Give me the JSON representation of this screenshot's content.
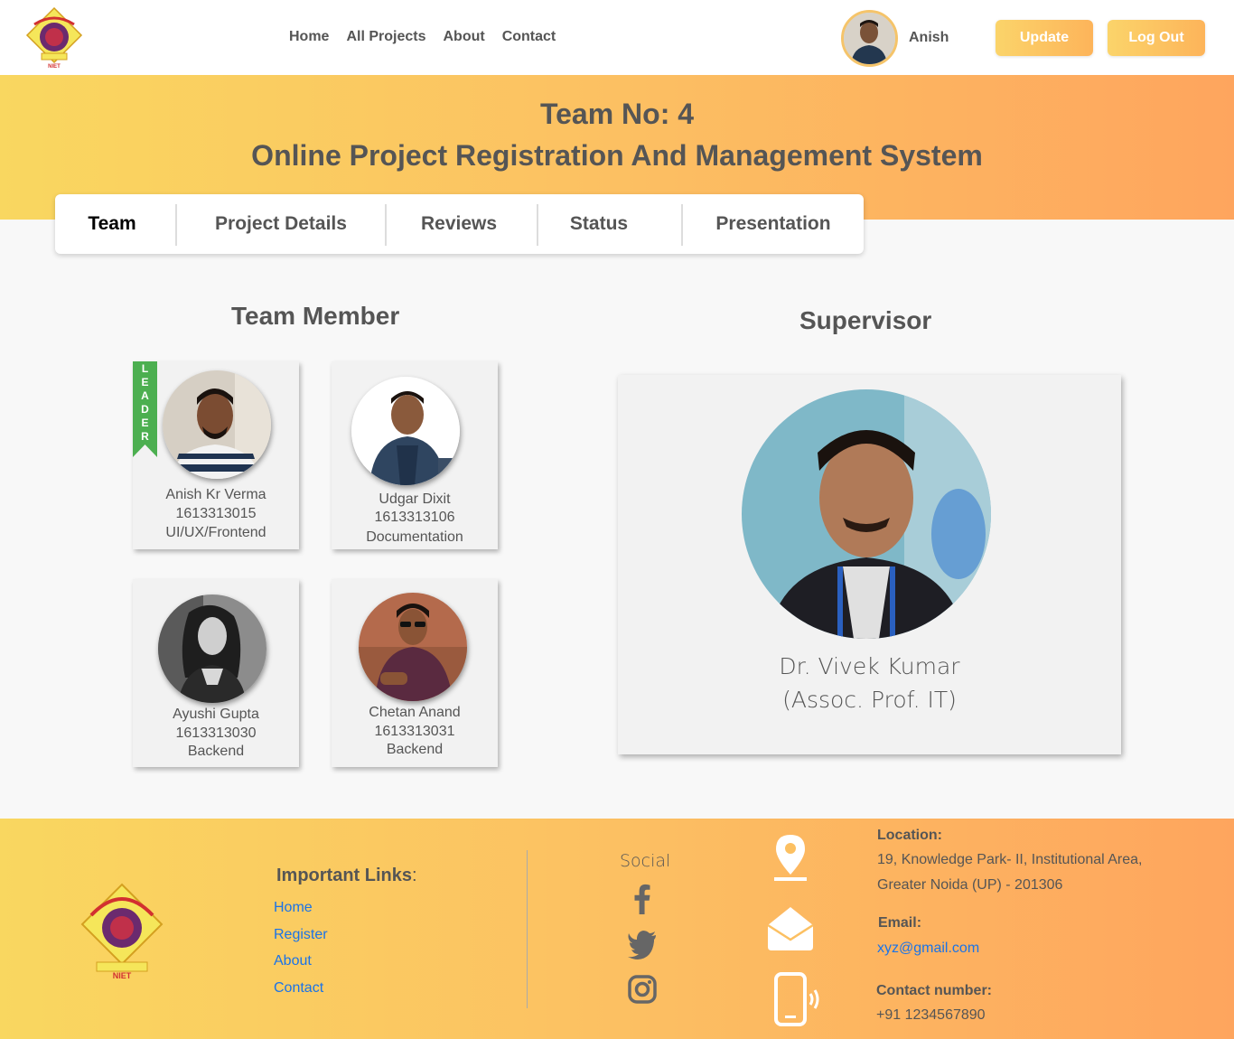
{
  "navbar": {
    "links": [
      "Home",
      "All Projects",
      "About",
      "Contact"
    ],
    "user_name": "Anish",
    "update_label": "Update",
    "logout_label": "Log Out"
  },
  "hero": {
    "team_no": "Team No: 4",
    "project_title": "Online Project Registration And Management System"
  },
  "tabs": [
    "Team",
    "Project Details",
    "Reviews",
    "Status",
    "Presentation"
  ],
  "active_tab": "Team",
  "team_section": {
    "heading": "Team Member",
    "leader_badge": "LEADER",
    "members": [
      {
        "name": "Anish Kr Verma",
        "roll": "1613313015",
        "role": "UI/UX/Frontend",
        "leader": true
      },
      {
        "name": "Udgar Dixit",
        "roll": "1613313106",
        "role": "Documentation",
        "leader": false
      },
      {
        "name": "Ayushi Gupta",
        "roll": "1613313030",
        "role": "Backend",
        "leader": false
      },
      {
        "name": "Chetan Anand",
        "roll": "1613313031",
        "role": "Backend",
        "leader": false
      }
    ]
  },
  "supervisor": {
    "heading": "Supervisor",
    "name": "Dr. Vivek Kumar",
    "designation": "(Assoc. Prof. IT)"
  },
  "footer": {
    "links_title": "Important Links",
    "links_colon": ":",
    "links": [
      "Home",
      "Register",
      "About",
      "Contact"
    ],
    "social_title": "Social",
    "social_icons": [
      "facebook-icon",
      "twitter-icon",
      "instagram-icon"
    ],
    "location_label": "Location:",
    "location_line1": "19, Knowledge Park- II, Institutional Area,",
    "location_line2": "Greater Noida (UP) - 201306",
    "email_label": "Email:",
    "email": "xyz@gmail.com",
    "contact_label": "Contact number:",
    "contact_number": "+91 1234567890"
  },
  "colors": {
    "gradient_start": "#f9d760",
    "gradient_end": "#fea55e",
    "leader_ribbon": "#4caf50",
    "link_blue": "#1a73e8"
  }
}
